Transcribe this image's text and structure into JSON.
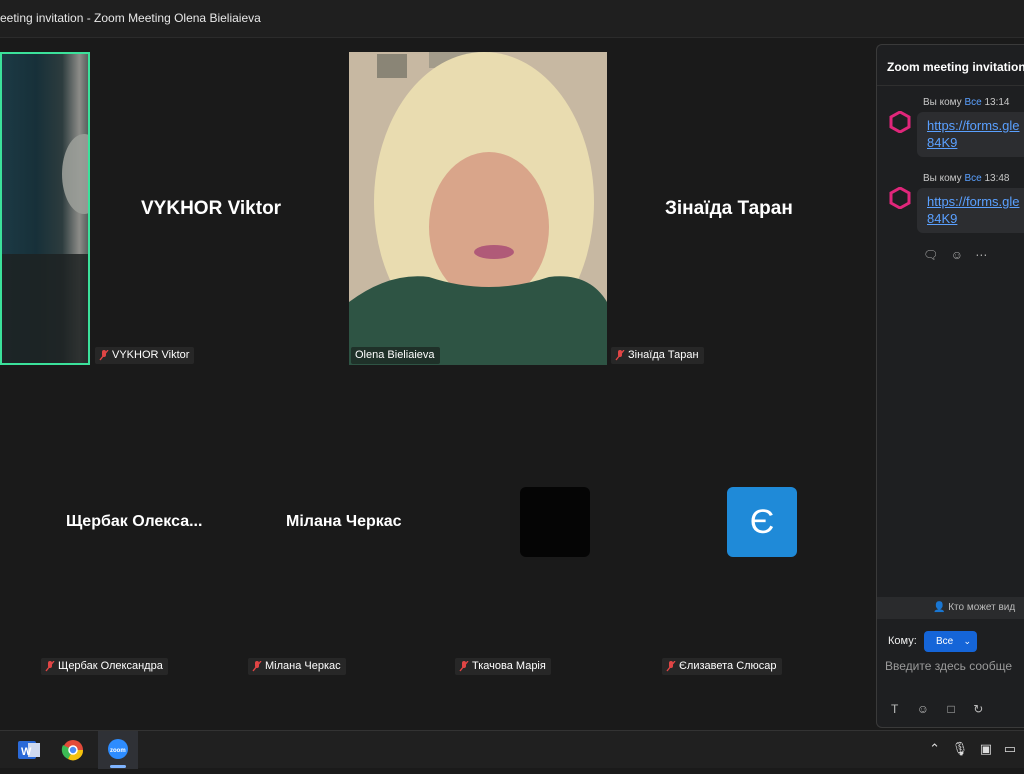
{
  "window": {
    "title": "eeting invitation - Zoom Meeting Olena Bieliaieva"
  },
  "participants": [
    {
      "tile_name": "VYKHOR Viktor",
      "tag": "VYKHOR Viktor"
    },
    {
      "tile_name": "",
      "tag": "Olena Bieliaieva"
    },
    {
      "tile_name": "Зінаїда Таран",
      "tag": "Зінаїда Таран"
    },
    {
      "tile_name": "Щербак  Олекса...",
      "tag": "Щербак Олександра"
    },
    {
      "tile_name": "Мілана Черкас",
      "tag": "Мілана Черкас"
    },
    {
      "tile_name": "",
      "tag": "Ткачова Марія"
    },
    {
      "tile_name": "",
      "tag": "Єлизавета Слюсар",
      "avatar_letter": "Є"
    }
  ],
  "chat": {
    "header": "Zoom meeting invitation",
    "messages": [
      {
        "from": "Вы кому",
        "to": "Все",
        "time": "13:14",
        "line1": "https://forms.gle",
        "line2": "84K9"
      },
      {
        "from": "Вы кому",
        "to": "Все",
        "time": "13:48",
        "line1": "https://forms.gle",
        "line2": "84K9"
      }
    ],
    "who_can_see": "Кто может вид",
    "to_label": "Кому:",
    "to_value": "Все",
    "input_placeholder": "Введите здесь сообще"
  },
  "colors": {
    "active_speaker_border": "#3be19b",
    "link": "#5aa0ff",
    "avatar_bg": "#1f8ad8",
    "send_to_button": "#1565d8",
    "muted_mic": "#e04545"
  },
  "taskbar": {
    "apps": [
      "word-icon",
      "chrome-icon",
      "zoom-icon"
    ]
  }
}
